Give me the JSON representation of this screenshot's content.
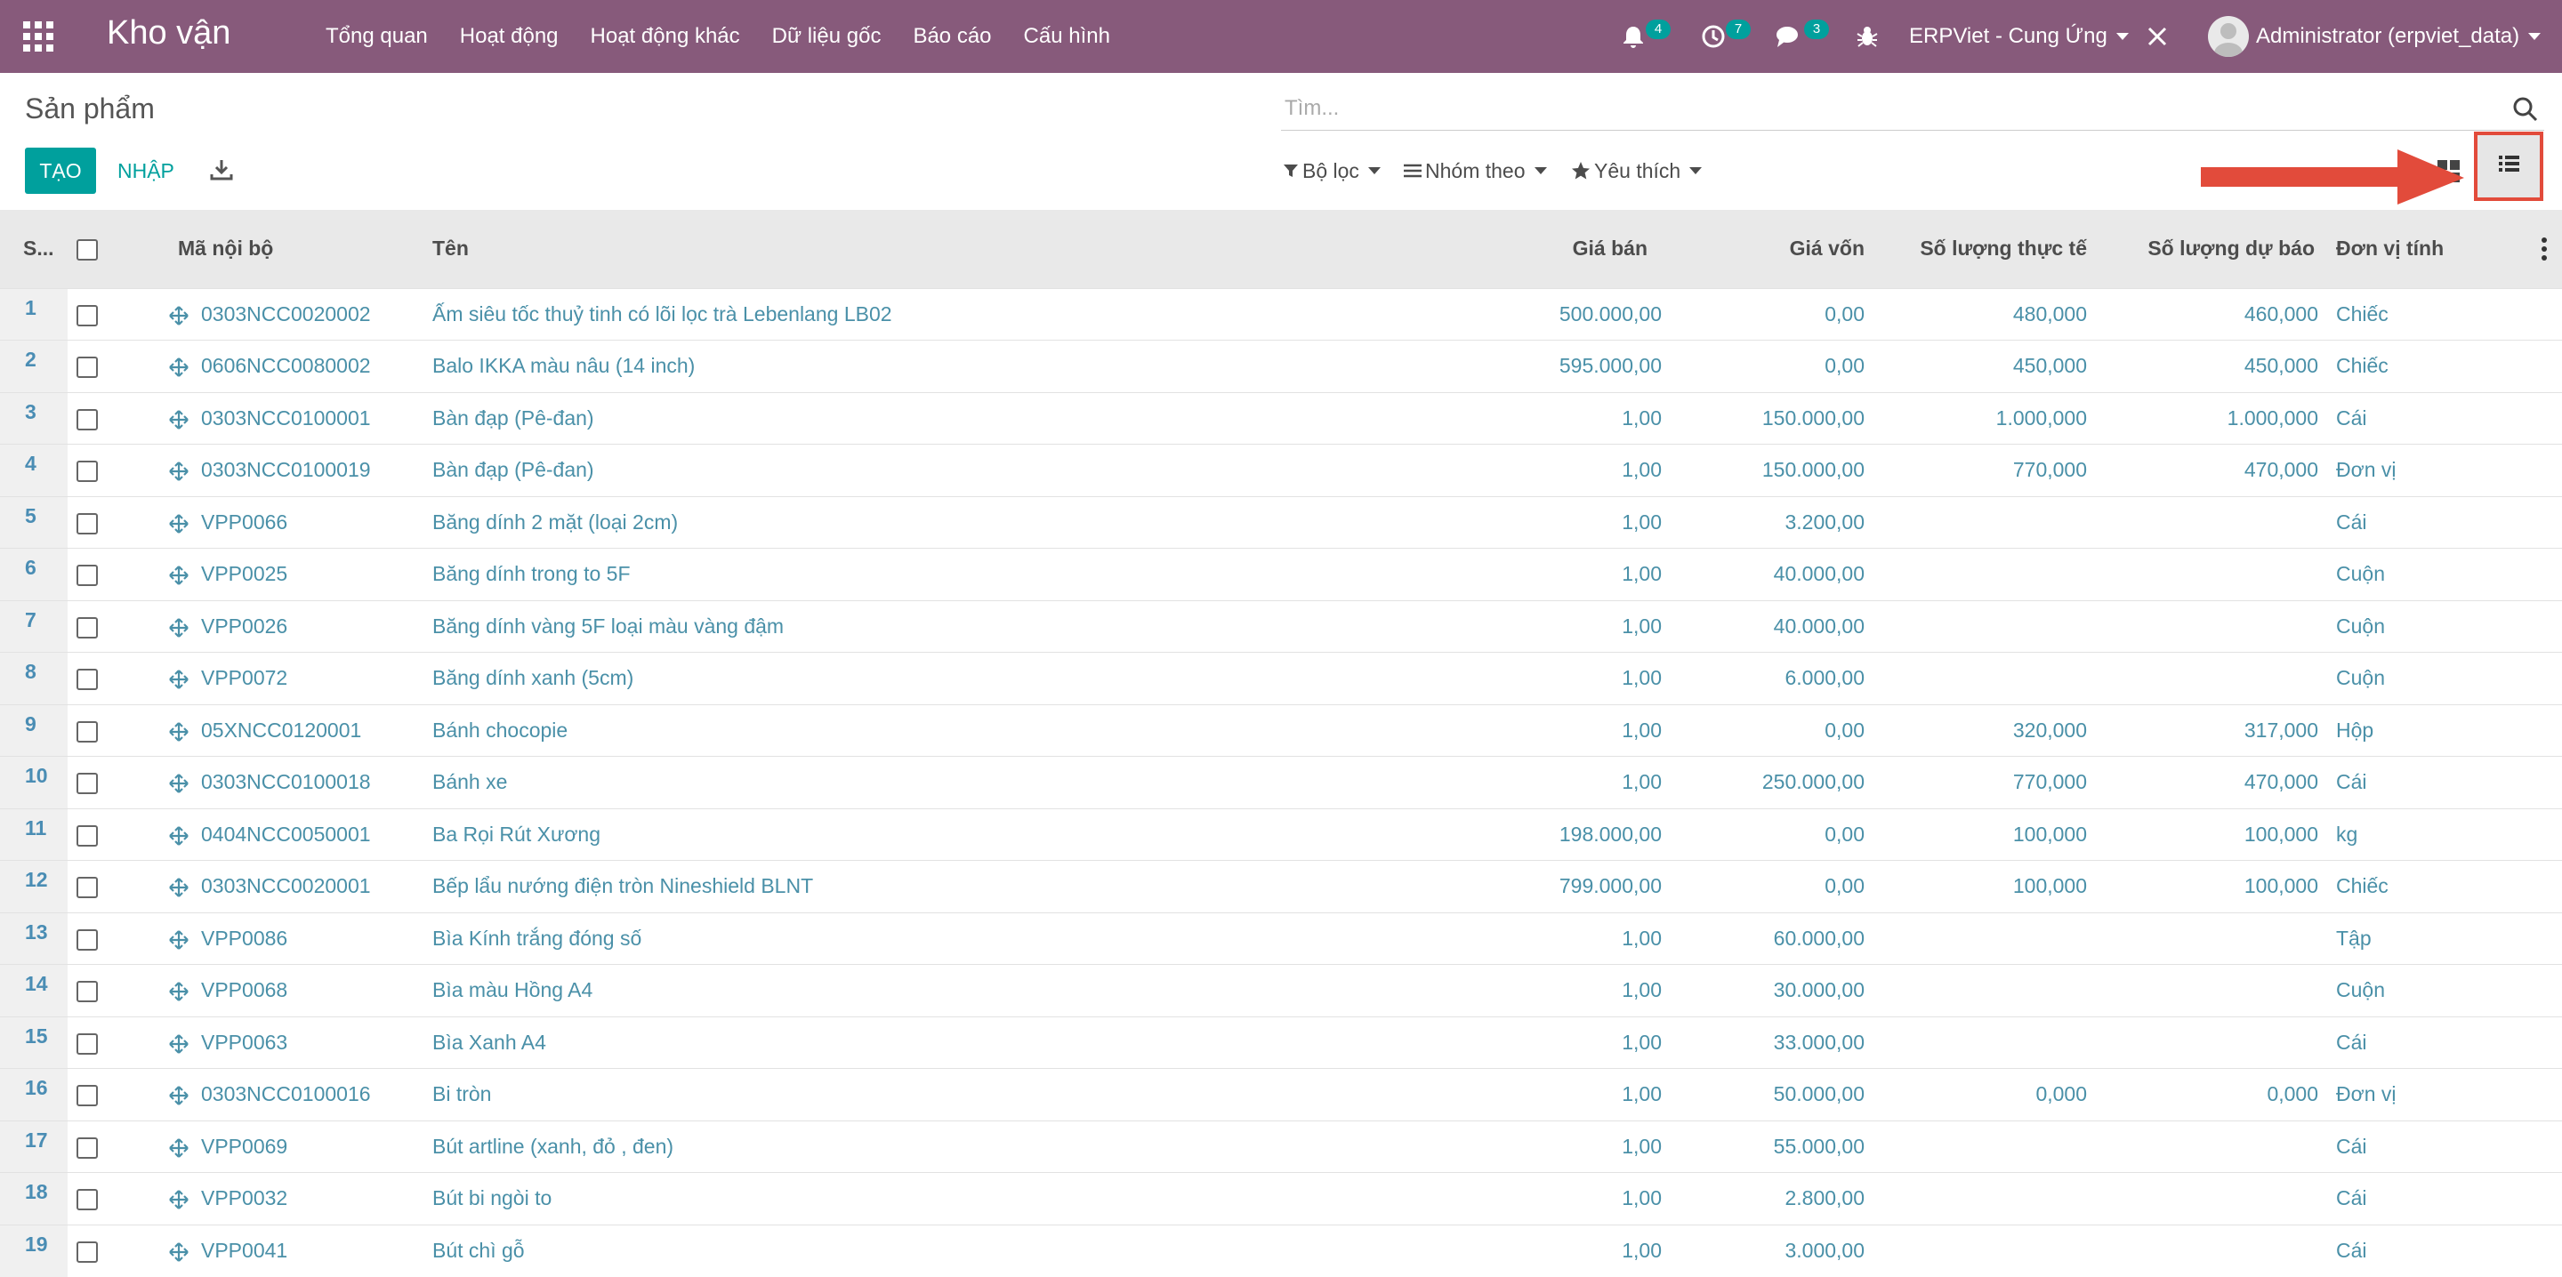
{
  "topbar": {
    "app_name": "Kho vận",
    "menu": [
      "Tổng quan",
      "Hoạt động",
      "Hoạt động khác",
      "Dữ liệu gốc",
      "Báo cáo",
      "Cấu hình"
    ],
    "notifications_count": "4",
    "activities_count": "7",
    "messages_count": "3",
    "company": "ERPViet - Cung Ứng",
    "user": "Administrator (erpviet_data)",
    "brand_color": "#875a7b",
    "badge_color": "#00a09d"
  },
  "control_panel": {
    "title": "Sản phẩm",
    "search_placeholder": "Tìm...",
    "create_label": "TẠO",
    "import_label": "NHẬP",
    "filters_label": "Bộ lọc",
    "group_by_label": "Nhóm theo",
    "favorites_label": "Yêu thích"
  },
  "table": {
    "columns": [
      "S...",
      "Mã nội bộ",
      "Tên",
      "Giá bán",
      "Giá vốn",
      "Số lượng thực tế",
      "Số lượng dự báo",
      "Đơn vị tính"
    ],
    "rows": [
      {
        "seq": "1",
        "code": "0303NCC0020002",
        "name": "Ấm siêu tốc thuỷ tinh có lõi lọc trà Lebenlang LB02",
        "price": "500.000,00",
        "cost": "0,00",
        "qty": "480,000",
        "forecast": "460,000",
        "uom": "Chiếc"
      },
      {
        "seq": "2",
        "code": "0606NCC0080002",
        "name": "Balo IKKA màu nâu (14 inch)",
        "price": "595.000,00",
        "cost": "0,00",
        "qty": "450,000",
        "forecast": "450,000",
        "uom": "Chiếc"
      },
      {
        "seq": "3",
        "code": "0303NCC0100001",
        "name": "Bàn đạp (Pê-đan)",
        "price": "1,00",
        "cost": "150.000,00",
        "qty": "1.000,000",
        "forecast": "1.000,000",
        "uom": "Cái"
      },
      {
        "seq": "4",
        "code": "0303NCC0100019",
        "name": "Bàn đạp (Pê-đan)",
        "price": "1,00",
        "cost": "150.000,00",
        "qty": "770,000",
        "forecast": "470,000",
        "uom": "Đơn vị"
      },
      {
        "seq": "5",
        "code": "VPP0066",
        "name": "Băng dính 2 mặt (loại 2cm)",
        "price": "1,00",
        "cost": "3.200,00",
        "qty": "",
        "forecast": "",
        "uom": "Cái"
      },
      {
        "seq": "6",
        "code": "VPP0025",
        "name": "Băng dính trong to 5F",
        "price": "1,00",
        "cost": "40.000,00",
        "qty": "",
        "forecast": "",
        "uom": "Cuộn"
      },
      {
        "seq": "7",
        "code": "VPP0026",
        "name": "Băng dính vàng 5F loại màu vàng đậm",
        "price": "1,00",
        "cost": "40.000,00",
        "qty": "",
        "forecast": "",
        "uom": "Cuộn"
      },
      {
        "seq": "8",
        "code": "VPP0072",
        "name": "Băng dính xanh (5cm)",
        "price": "1,00",
        "cost": "6.000,00",
        "qty": "",
        "forecast": "",
        "uom": "Cuộn"
      },
      {
        "seq": "9",
        "code": "05XNCC0120001",
        "name": "Bánh chocopie",
        "price": "1,00",
        "cost": "0,00",
        "qty": "320,000",
        "forecast": "317,000",
        "uom": "Hộp"
      },
      {
        "seq": "10",
        "code": "0303NCC0100018",
        "name": "Bánh xe",
        "price": "1,00",
        "cost": "250.000,00",
        "qty": "770,000",
        "forecast": "470,000",
        "uom": "Cái"
      },
      {
        "seq": "11",
        "code": "0404NCC0050001",
        "name": "Ba Rọi Rút Xương",
        "price": "198.000,00",
        "cost": "0,00",
        "qty": "100,000",
        "forecast": "100,000",
        "uom": "kg"
      },
      {
        "seq": "12",
        "code": "0303NCC0020001",
        "name": "Bếp lẩu nướng điện tròn Nineshield BLNT",
        "price": "799.000,00",
        "cost": "0,00",
        "qty": "100,000",
        "forecast": "100,000",
        "uom": "Chiếc"
      },
      {
        "seq": "13",
        "code": "VPP0086",
        "name": "Bìa Kính trắng đóng số",
        "price": "1,00",
        "cost": "60.000,00",
        "qty": "",
        "forecast": "",
        "uom": "Tập"
      },
      {
        "seq": "14",
        "code": "VPP0068",
        "name": "Bìa màu Hồng A4",
        "price": "1,00",
        "cost": "30.000,00",
        "qty": "",
        "forecast": "",
        "uom": "Cuộn"
      },
      {
        "seq": "15",
        "code": "VPP0063",
        "name": "Bìa Xanh A4",
        "price": "1,00",
        "cost": "33.000,00",
        "qty": "",
        "forecast": "",
        "uom": "Cái"
      },
      {
        "seq": "16",
        "code": "0303NCC0100016",
        "name": "Bi tròn",
        "price": "1,00",
        "cost": "50.000,00",
        "qty": "0,000",
        "forecast": "0,000",
        "uom": "Đơn vị"
      },
      {
        "seq": "17",
        "code": "VPP0069",
        "name": "Bút artline (xanh, đỏ , đen)",
        "price": "1,00",
        "cost": "55.000,00",
        "qty": "",
        "forecast": "",
        "uom": "Cái"
      },
      {
        "seq": "18",
        "code": "VPP0032",
        "name": "Bút bi ngòi to",
        "price": "1,00",
        "cost": "2.800,00",
        "qty": "",
        "forecast": "",
        "uom": "Cái"
      },
      {
        "seq": "19",
        "code": "VPP0041",
        "name": "Bút chì gỗ",
        "price": "1,00",
        "cost": "3.000,00",
        "qty": "",
        "forecast": "",
        "uom": "Cái"
      }
    ]
  }
}
